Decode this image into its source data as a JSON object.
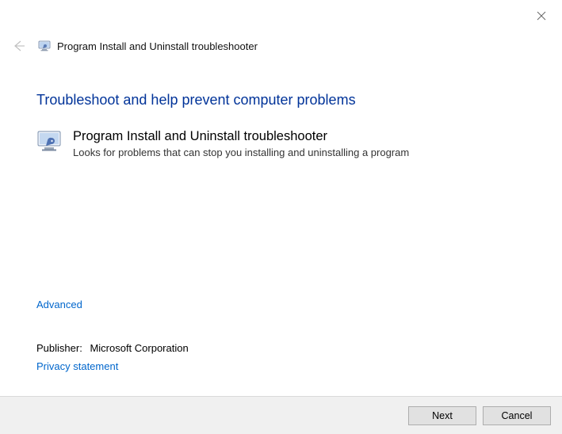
{
  "window": {
    "title": "Program Install and Uninstall troubleshooter"
  },
  "heading": "Troubleshoot and help prevent computer problems",
  "item": {
    "name": "Program Install and Uninstall troubleshooter",
    "description": "Looks for problems that can stop you installing and uninstalling a program"
  },
  "links": {
    "advanced": "Advanced",
    "privacy": "Privacy statement"
  },
  "publisher": {
    "label": "Publisher:",
    "name": "Microsoft Corporation"
  },
  "buttons": {
    "next": "Next",
    "cancel": "Cancel"
  }
}
